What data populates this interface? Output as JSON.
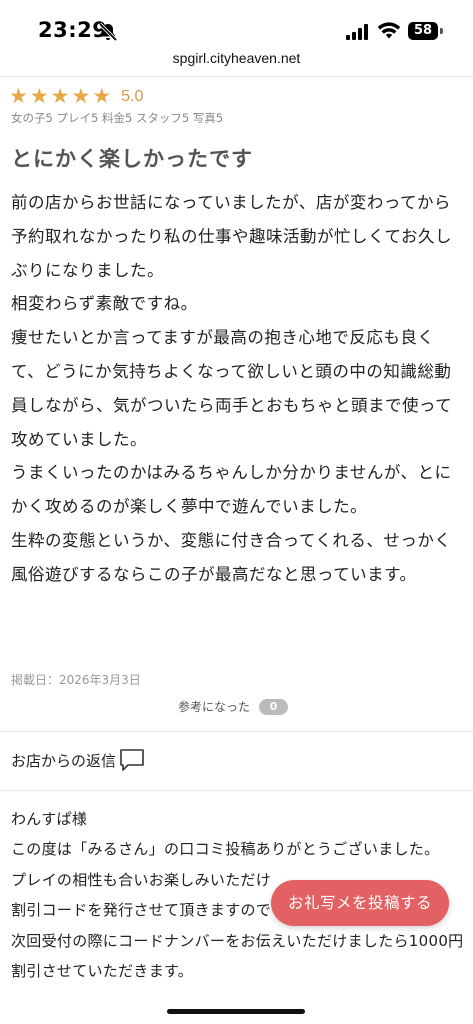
{
  "status_bar": {
    "time": "23:29",
    "battery": "58"
  },
  "browser": {
    "url": "spgirl.cityheaven.net"
  },
  "review": {
    "stars": [
      "★",
      "★",
      "★",
      "★",
      "★"
    ],
    "rating": "5.0",
    "sub_ratings": "女の子5 プレイ5 料金5 スタッフ5 写真5",
    "title": "とにかく楽しかったです",
    "paragraphs": [
      "前の店からお世話になっていましたが、店が変わってから予約取れなかったり私の仕事や趣味活動が忙しくてお久しぶりになりました。",
      "相変わらず素敵ですね。",
      "痩せたいとか言ってますが最高の抱き心地で反応も良くて、どうにか気持ちよくなって欲しいと頭の中の知識総動員しながら、気がついたら両手とおもちゃと頭まで使って攻めていました。",
      "うまくいったのかはみるちゃんしか分かりませんが、とにかく攻めるのが楽しく夢中で遊んでいました。",
      "生粋の変態というか、変態に付き合ってくれる、せっかく風俗遊びするならこの子が最高だなと思っています。"
    ],
    "posted_date": "掲載日：2026年3月3日",
    "helpful_label": "参考になった",
    "helpful_count": "0"
  },
  "shop_reply": {
    "heading": "お店からの返信",
    "lines": [
      "わんすぱ様",
      "この度は「みるさん」の口コミ投稿ありがとうございました。",
      "プレイの相性も合いお楽しみいただけ",
      "割引コードを発行させて頂きますので",
      "次回受付の際にコードナンバーをお伝えいただけましたら1000円割引させていただきます。"
    ]
  },
  "fab": {
    "label": "お礼写メを投稿する"
  },
  "colors": {
    "star": "#e8a84a",
    "fab": "#e36163"
  }
}
